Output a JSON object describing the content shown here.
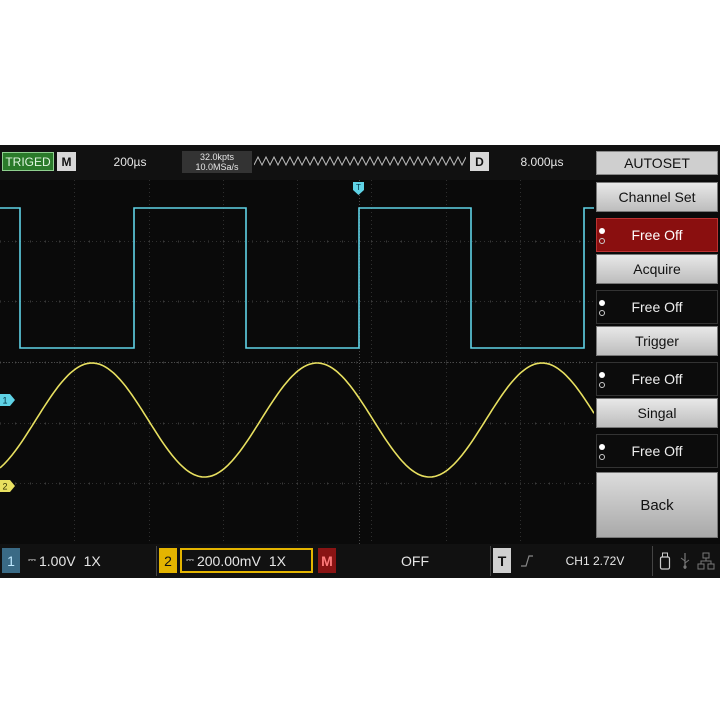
{
  "topbar": {
    "status": "TRIGED",
    "mode_badge": "M",
    "timebase": "200µs",
    "memory_depth": "32.0kpts",
    "sample_rate": "10.0MSa/s",
    "delay_badge": "D",
    "delay": "8.000µs",
    "autoset_label": "AUTOSET"
  },
  "menu": {
    "items": [
      {
        "title": "Channel Set",
        "option": "Free Off",
        "active": true
      },
      {
        "title": "Acquire",
        "option": "Free Off",
        "active": false
      },
      {
        "title": "Trigger",
        "option": "Free Off",
        "active": false
      },
      {
        "title": "Singal",
        "option": "Free Off",
        "active": false
      }
    ],
    "back_label": "Back"
  },
  "markers": {
    "trigger_marker": "T",
    "ch1_marker": "1",
    "ch2_marker": "2"
  },
  "bottombar": {
    "ch1_num": "1",
    "ch1_scale": "1.00V",
    "ch1_probe": "1X",
    "ch2_num": "2",
    "ch2_scale": "200.00mV",
    "ch2_probe": "1X",
    "math_label": "M",
    "math_value": "OFF",
    "trigger_label": "T",
    "trigger_info": "CH1 2.72V"
  },
  "colors": {
    "ch1": "#5fd3e6",
    "ch2": "#e8e060",
    "active_menu": "#8a0f0f",
    "triged": "#2a7a2a"
  }
}
